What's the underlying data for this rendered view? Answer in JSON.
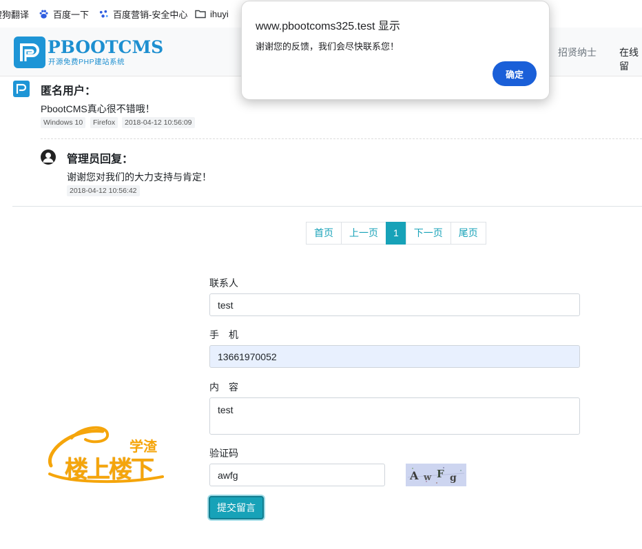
{
  "bookmarks": [
    {
      "label": "搜狗翻译",
      "icon": "sogou-icon"
    },
    {
      "label": "百度一下",
      "icon": "baidu-paw-icon"
    },
    {
      "label": "百度营销-安全中心",
      "icon": "baidu-marketing-icon"
    },
    {
      "label": "ihuyi",
      "icon": "folder-icon"
    }
  ],
  "header": {
    "logo_text": "PBOOTCMS",
    "logo_subtitle": "开源免费PHP建站系统",
    "nav": [
      "招贤纳士",
      "在线留"
    ]
  },
  "comment": {
    "user": "匿名用户：",
    "text": "PbootCMS真心很不错哦！",
    "tags": [
      "Windows 10",
      "Firefox",
      "2018-04-12 10:56:09"
    ]
  },
  "reply": {
    "user": "管理员回复：",
    "text": "谢谢您对我们的大力支持与肯定！",
    "time": "2018-04-12 10:56:42"
  },
  "pagination": {
    "first": "首页",
    "prev": "上一页",
    "current": "1",
    "next": "下一页",
    "last": "尾页"
  },
  "form": {
    "contact_label": "联系人",
    "contact_value": "test",
    "mobile_label": "手　机",
    "mobile_value": "13661970052",
    "content_label": "内　容",
    "content_value": "test",
    "captcha_label": "验证码",
    "captcha_value": "awfg",
    "captcha_image_text": "AwFg",
    "submit_label": "提交留言"
  },
  "watermark": {
    "line1": "学渣",
    "line2": "楼上楼下"
  },
  "dialog": {
    "title": "www.pbootcoms325.test 显示",
    "message": "谢谢您的反馈，我们会尽快联系您！",
    "ok_label": "确定"
  },
  "colors": {
    "accent": "#17a2b8",
    "logo_blue": "#1d8fd0",
    "dialog_button": "#1a5fd8",
    "watermark_orange": "#f5a50b"
  }
}
